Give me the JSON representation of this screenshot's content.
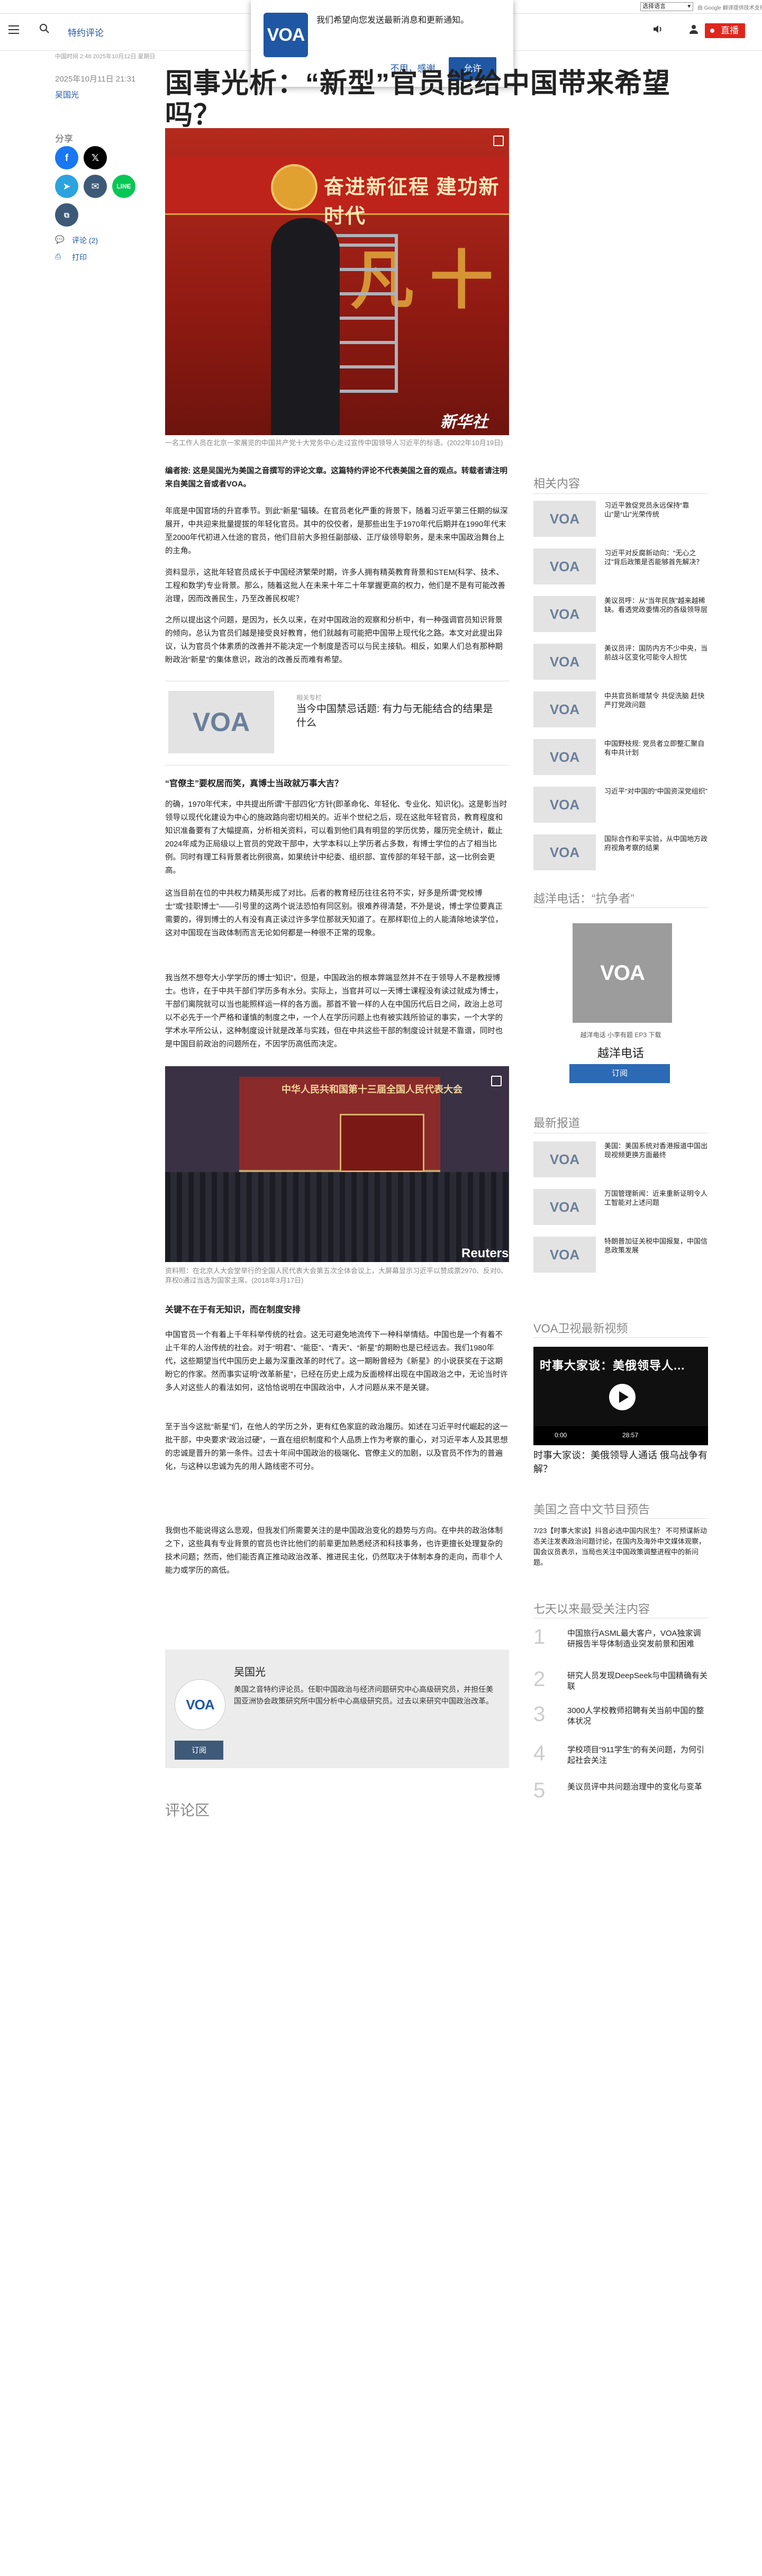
{
  "translate": {
    "select": "选择语言",
    "powered": "由 Google 翻译提供技术支持"
  },
  "header": {
    "section": "特约评论",
    "live": "直播"
  },
  "popup": {
    "text": "我们希望向您发送最新消息和更新通知。",
    "no": "不用，感谢",
    "yes": "允许",
    "logo": "VOA"
  },
  "meta": {
    "updated": "中国时间 2:48 2025年10月12日 星期日",
    "date": "2025年10月11日 21:31",
    "author": "吴国光"
  },
  "title": "国事光析：“新型”官员能给中国带来希望吗？",
  "share": {
    "label": "分享",
    "comments": "评论 (2)",
    "print": "打印"
  },
  "hero": {
    "banner": "奋进新征程 建功新时代",
    "big": "非凡十年",
    "wm": "新华社"
  },
  "hero_caption": "一名工作人员在北京一家展览的中国共产党十大党务中心走过宣传中国领导人习近平的标语。(2022年10月19日)",
  "lede": "编者按: 这是吴国光为美国之音撰写的评论文章。这篇特约评论不代表美国之音的观点。转载者请注明来自美国之音或者VOA。",
  "p1": "年底是中国官场的升官季节。到此“新星”辐辏。在官员老化严重的背景下，随着习近平第三任期的纵深展开，中共迎来批量提拔的年轻化官员。其中的佼佼者，是那些出生于1970年代后期并在1990年代末至2000年代初进入仕途的官员，他们目前大多担任副部级、正厅级领导职务，是未来中国政治舞台上的主角。",
  "p2": "资料显示，这批年轻官员成长于中国经济繁荣时期，许多人拥有精英教育背景和STEM(科学、技术、工程和数学)专业背景。那么，随着这批人在未来十年二十年掌握更高的权力，他们是不是有可能改善治理，因而改善民生，乃至改善民权呢？",
  "p3": "之所以提出这个问题，是因为，长久以来，在对中国政治的观察和分析中，有一种强调官员知识背景的倾向，总认为官员们越是接受良好教育，他们就越有可能把中国带上现代化之路。本文对此提出异议，认为官员个体素质的改善并不能决定一个制度是否可以与民主接轨。相反，如果人们总有那种期盼政治“新星”的集体意识，政治的改善反而难有希望。",
  "related": {
    "label": "相关专栏",
    "title": "当今中国禁忌话题: 有力与无能结合的结果是什么"
  },
  "h1": "“官僚主”要权居而笑，真博士当政就万事大吉？",
  "p4": "的确，1970年代末，中共提出所谓“干部四化”方针(即革命化、年轻化、专业化、知识化)。这是彰当时领导以现代化建设为中心的施政路向密切相关的。近半个世纪之后，现在这批年轻官员，教育程度和知识准备要有了大幅提高，分析相关资料，可以看到他们具有明显的学历优势，履历完全统计，截止2024年成为正局级以上官员的党政干部中，大学本科以上学历者占多数，有博士学位的占了相当比例。同时有理工科背景者比例很高，如果统计中纪委、组织部、宣传部的年轻干部，这一比例会更高。",
  "p5": "这当目前在位的中共权力精英形成了对比。后者的教育经历往往名符不实，好多是所谓“党校博士”或“挂职博士”——引号里的这两个说法恐怕有同区别。很难养得清楚，不外是说，博士学位要真正需要的，得到博士的人有没有真正读过许多学位那就天知道了。在那样职位上的人能清除地读学位，这对中国现在当政体制而言无论如何都是一种很不正常的现象。",
  "p6": "我当然不想夸大小学学历的博士“知识”，但是，中国政治的根本弊端显然并不在于领导人不是教授博士。也许，在于中共干部们学历多有水分。实际上，当官并可以一天博士课程没有读过就成为博士，干部们离院就可以当也能照样运一样的各方面。那首不管一样的人在中国历代后日之间，政治上总可以不必先于一个严格和谨慎的制度之中，一个人在学历问题上也有被实践所验证的事实，一个大学的学术水平所公认，这种制度设计就是改革与实践，但在中共这些干部的制度设计就是不靠谱，同时也是中国目前政治的问题所在，不因学历高低而决定。",
  "photo2_caption": "资料照：在北京人大会堂举行的全国人民代表大会第五次全体会议上，大屏幕显示习近平以赞成票2970、反对0、弃权0通过当选为国家主席。(2018年3月17日)",
  "h2": "关键不在于有无知识，而在制度安排",
  "p7": "中国官员一个有着上千年科举传统的社会。这无可避免地流传下一种科举情结。中国也是一个有着不止千年的人治传统的社会。对于“明君”、“能臣”、“青天”、“新星”的期盼也是已经远去。我们1980年代，这些期望当代中国历史上最为深重改革的时代了。这一期盼曾经为《新星》的小说获奖在于这期盼它的作家。然而事实证明“改革新星”，已经在历史上成为反面榜样出现在中国政治之中，无论当时许多人对这些人的看法如何，这恰恰说明在中国政治中，人才问题从来不是关键。",
  "p8": "至于当今这批“新星”们，在他人的学历之外，更有红色家庭的政治履历。如述在习近平时代崛起的这一批干部，中央要求“政治过硬”，一直在组织制度和个人品质上作为考察的重心，对习近平本人及其思想的忠诚是晋升的第一条件。过去十年间中国政治的极端化、官僚主义的加剧，以及官员不作为的普遍化，与这种以忠诚为先的用人路线密不可分。",
  "p9": "我倒也不能说得这么悲观，但我发们所需要关注的是中国政治变化的趋势与方向。在中共的政治体制之下，这些具有专业背景的官员也许比他们的前辈更加熟悉经济和科技事务，也许更擅长处理复杂的技术问题；然而，他们能否真正推动政治改革、推进民主化，仍然取决于体制本身的走向，而非个人能力或学历的高低。",
  "bio": {
    "name": "吴国光",
    "desc": "美国之音特约评论员。任职中国政治与经济问题研究中心高级研究员，并担任美国亚洲协会政策研究所中国分析中心高级研究员。过去以来研究中国政治改革。",
    "subscribe": "订阅"
  },
  "comments_head": "评论区",
  "right": {
    "related_head": "相关内容",
    "related": [
      "习近平敦促党员永远保持“靠山”是“山”光荣传统",
      "习近平对反腐新动向：“无心之过”背后政策是否能够首先解决？",
      "美议员呼：从“当年民族”越来越稀缺。看透党政委情况的各级领导层",
      "美议员评：国防内方不少中央，当前战斗区变化可能令人担忧",
      "中共官员新增禁令 共促洗脑 赶快严打党政问题",
      "中国野枝规: 党员者立即整汇聚自有中共计划",
      "习近平“对中国的“中国资深党组织”",
      "国际合作和平实验，从中国地方政府视角考察的结果"
    ],
    "radio_head": "越洋电话：“抗争者”",
    "radio_title": "越洋电话",
    "radio_meta": "越洋电话  小李有题  EP3 下载",
    "radio_sub": "订阅",
    "latest_head": "最新报道",
    "latest": [
      "美国：美国系统对香港报道中国出现视频更换方面最终",
      "万国管理新闻：近来重新证明令人工智能对上述问题",
      "特朗普加征关税中国报复，中国信息政策发展"
    ],
    "video_head": "VOA卫视最新视频",
    "video_title": "时事大家谈：美俄领导人...",
    "video_time": "0:00",
    "video_end": "28:57",
    "video_caption": "时事大家谈：美俄领导人通话 俄乌战争有解？",
    "preview_head": "美国之音中文节目预告",
    "preview": "7/23【时事大家谈】抖音必选中国内民生？ 不可预谋新动态关注发表政治问题讨论，在国内及海外中文媒体观察，国会议员表示，当局也关注中国政策调整进程中的新问题。",
    "most_head": "七天以来最受关注内容",
    "most": [
      "中国旅行ASML最大客户，VOA独家调研报告半导体制造业突发前景和困难",
      "研究人员发现DeepSeek与中国精确有关联",
      "3000人学校教师招聘有关当前中国的整体状况",
      "学校项目“911学生”的有关问题，为何引起社会关注",
      "美议员评中共问题治理中的变化与变革"
    ]
  },
  "photo2_text": "中华人民共和国第十三届全国人民代表大会",
  "colors": {
    "brand": "#1f57a4",
    "live": "#e0261c"
  }
}
